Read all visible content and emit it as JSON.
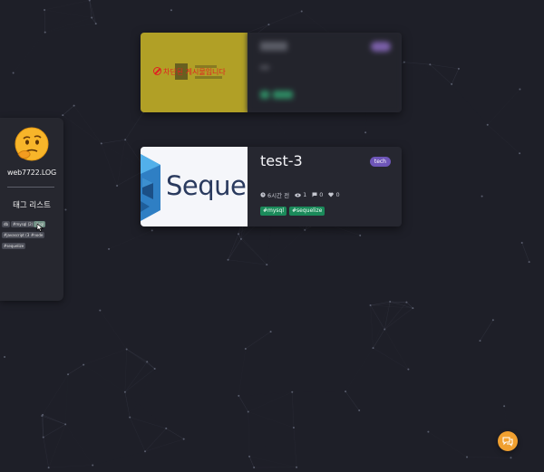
{
  "sidebar": {
    "blog_name": "web7722.LOG",
    "tag_list_title": "태그 리스트",
    "tags": [
      {
        "label": "db",
        "active": false
      },
      {
        "label": "#mysql (2)",
        "active": false
      },
      {
        "label": "#sql",
        "active": true
      },
      {
        "label": "#javascript (3)",
        "active": false
      },
      {
        "label": "#node",
        "active": false
      },
      {
        "label": "#sequelize",
        "active": false
      }
    ]
  },
  "posts": [
    {
      "blocked": true,
      "blocked_notice": "차단된 게시물입니다"
    },
    {
      "title": "test-3",
      "category": "tech",
      "thumbnail_text": "Seque",
      "time": "6시간 전",
      "views": "1",
      "comments": "0",
      "likes": "0",
      "tags": [
        "#mysql",
        "#sequelize"
      ]
    }
  ],
  "colors": {
    "background": "#1e1f28",
    "category_badge": "#6e56b8",
    "tag_chip": "#1b8a5a",
    "fab": "#f0a030",
    "blocked_thumb": "#b1a026"
  },
  "icons": [
    "clock-icon",
    "eye-icon",
    "comment-icon",
    "heart-icon",
    "chat-icon",
    "no-entry-icon"
  ]
}
